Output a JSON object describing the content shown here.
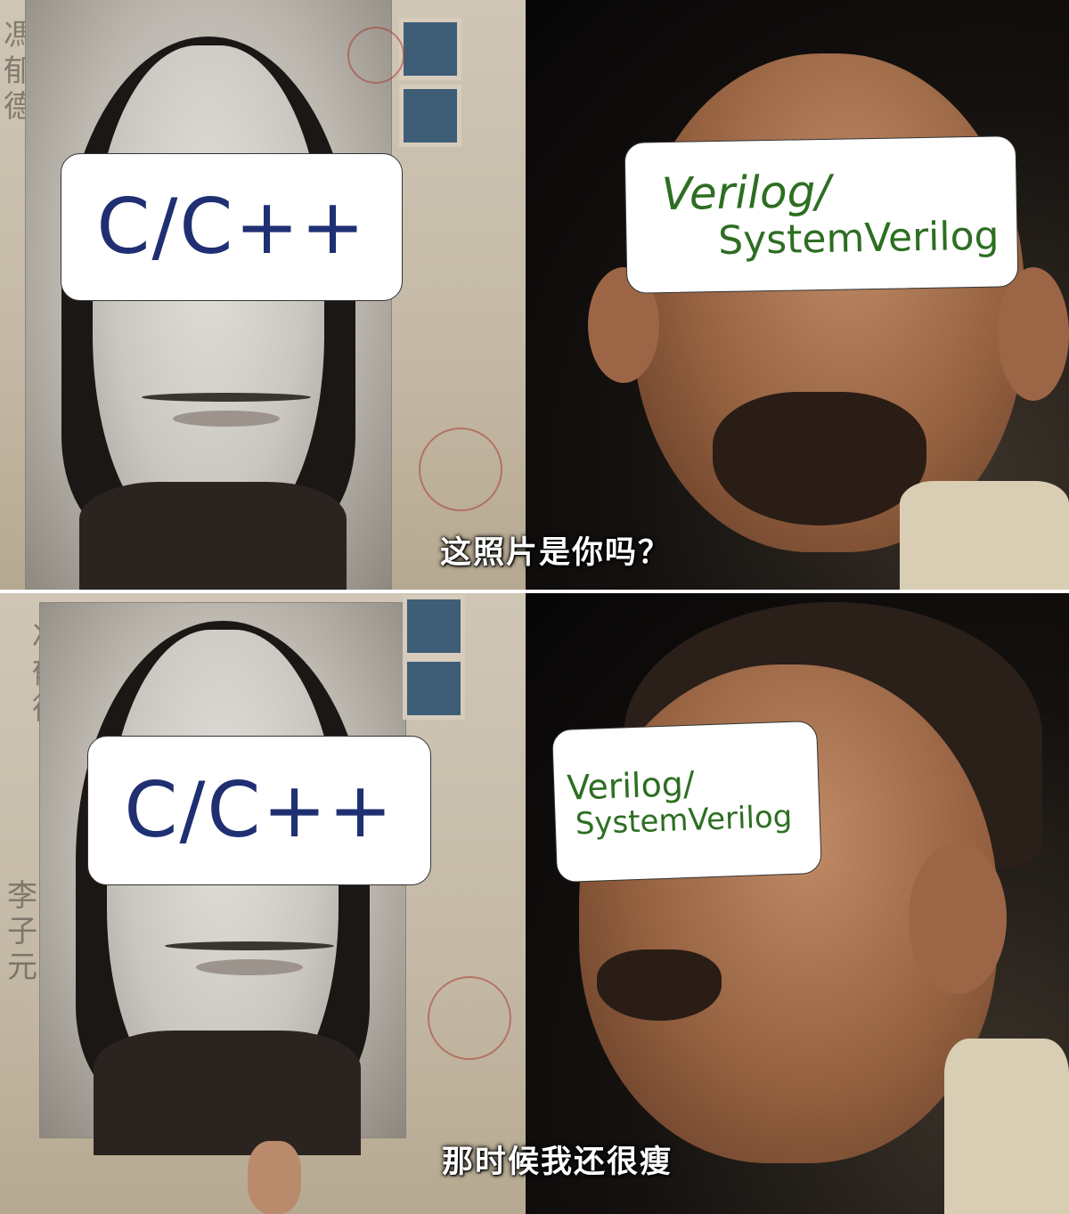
{
  "panels": [
    {
      "left_label": "C/C++",
      "right_label_line1": "Verilog/",
      "right_label_line2": "SystemVerilog",
      "subtitle": "这照片是你吗？"
    },
    {
      "left_label": "C/C++",
      "right_label_line1": "Verilog/",
      "right_label_line2": "SystemVerilog",
      "subtitle": "那时候我还很瘦"
    }
  ],
  "colors": {
    "cpp_text": "#1f2f72",
    "verilog_text": "#2d6e22",
    "label_background": "#ffffff",
    "subtitle_text": "#ffffff"
  }
}
